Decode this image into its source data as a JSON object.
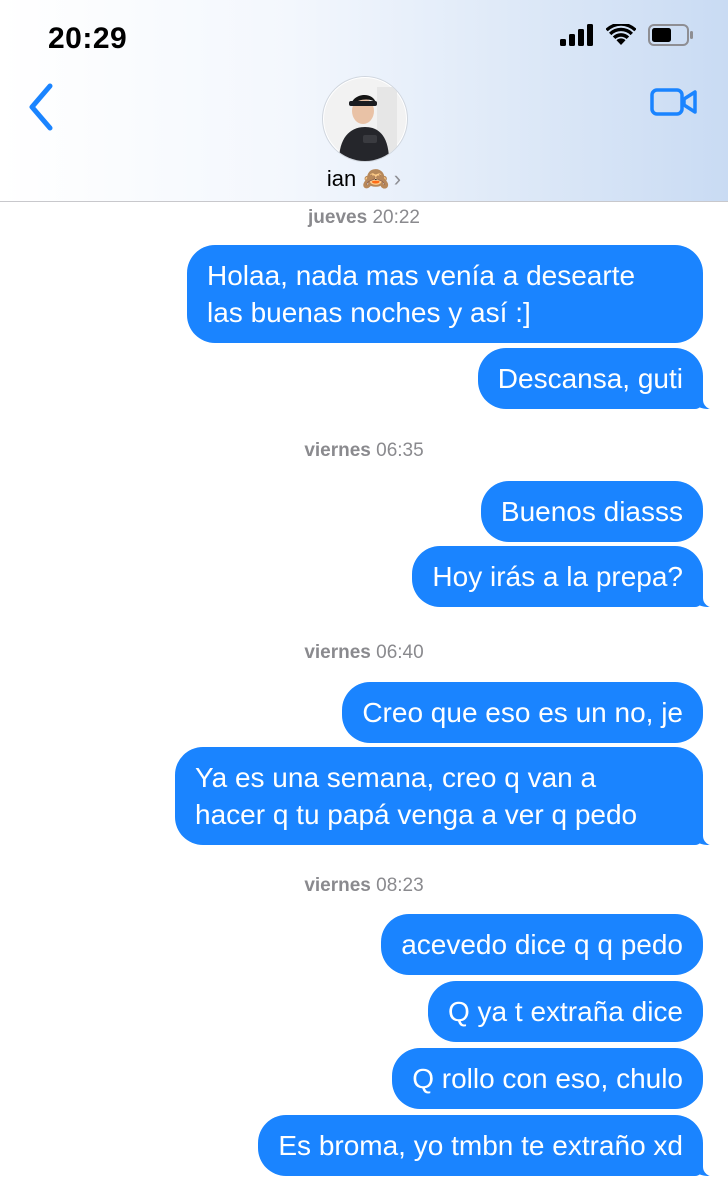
{
  "status_bar": {
    "time": "20:29"
  },
  "header": {
    "contact_name": "ian 🙈",
    "chevron": "›",
    "back_icon": "chevron-left-icon",
    "video_icon": "video-camera-icon",
    "accent_color": "#1a84ff"
  },
  "thread": {
    "groups": [
      {
        "day": "jueves",
        "time": "20:22",
        "messages": [
          "Holaa, nada mas venía a desearte\nlas buenas noches y así :]",
          "Descansa, guti"
        ]
      },
      {
        "day": "viernes",
        "time": "06:35",
        "messages": [
          "Buenos diasss",
          "Hoy irás a la prepa?"
        ]
      },
      {
        "day": "viernes",
        "time": "06:40",
        "messages": [
          "Creo que eso es un no, je",
          "Ya es una semana, creo q van a\nhacer q tu papá venga a ver q pedo"
        ]
      },
      {
        "day": "viernes",
        "time": "08:23",
        "messages": [
          "acevedo dice q q pedo",
          "Q ya t extraña dice",
          "Q rollo con eso, chulo",
          "Es broma, yo tmbn te extraño xd"
        ]
      }
    ]
  }
}
